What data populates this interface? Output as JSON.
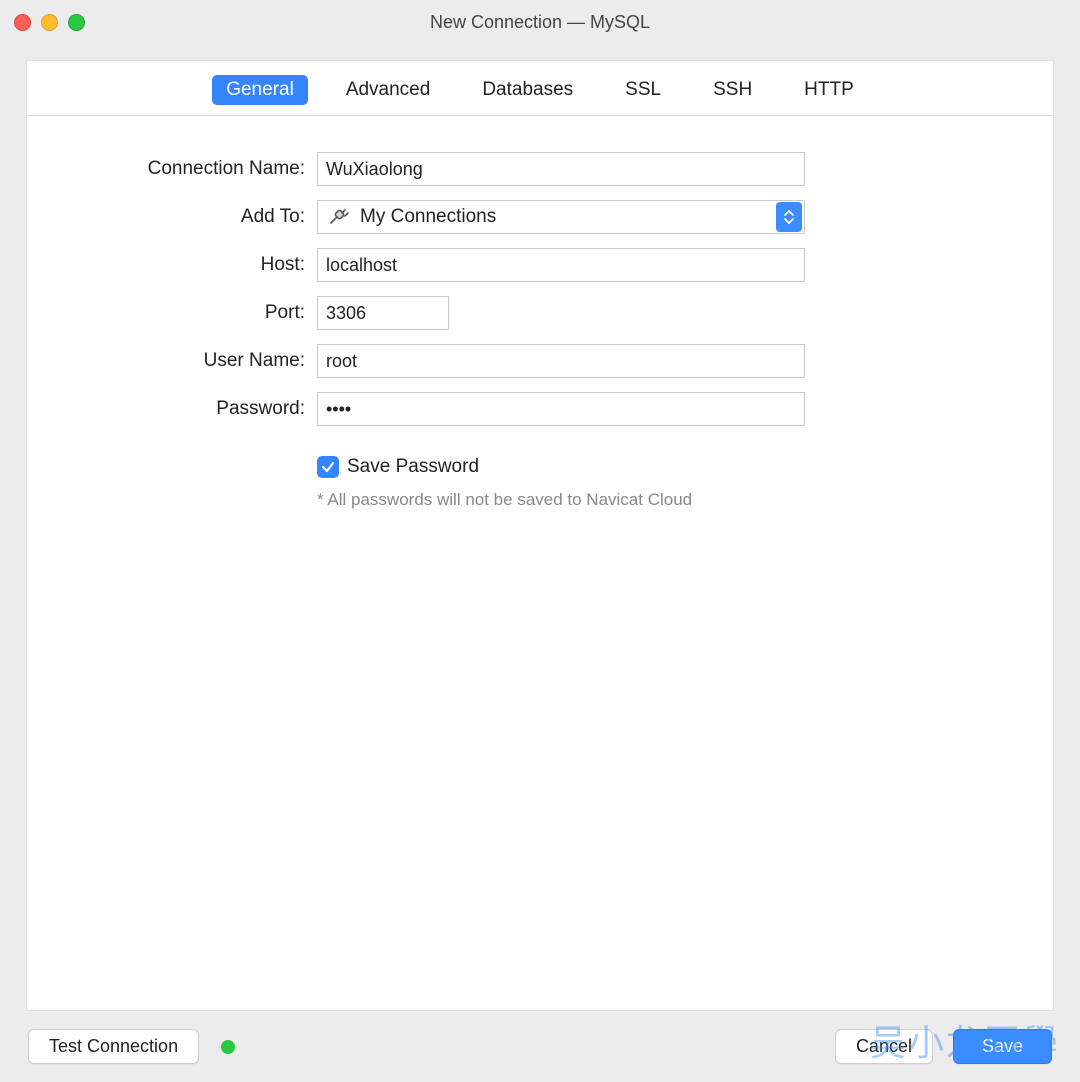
{
  "window": {
    "title": "New Connection — MySQL"
  },
  "tabs": [
    {
      "label": "General",
      "active": true
    },
    {
      "label": "Advanced",
      "active": false
    },
    {
      "label": "Databases",
      "active": false
    },
    {
      "label": "SSL",
      "active": false
    },
    {
      "label": "SSH",
      "active": false
    },
    {
      "label": "HTTP",
      "active": false
    }
  ],
  "form": {
    "connection_name_label": "Connection Name:",
    "connection_name_value": "WuXiaolong",
    "addto_label": "Add To:",
    "addto_value": "My Connections",
    "host_label": "Host:",
    "host_value": "localhost",
    "port_label": "Port:",
    "port_value": "3306",
    "username_label": "User Name:",
    "username_value": "root",
    "password_label": "Password:",
    "password_value": "••••",
    "save_password_label": "Save Password",
    "save_password_checked": true,
    "note": "* All passwords will not be saved to Navicat Cloud"
  },
  "footer": {
    "test_label": "Test Connection",
    "cancel_label": "Cancel",
    "save_label": "Save"
  },
  "watermark": "吴小龙同學"
}
